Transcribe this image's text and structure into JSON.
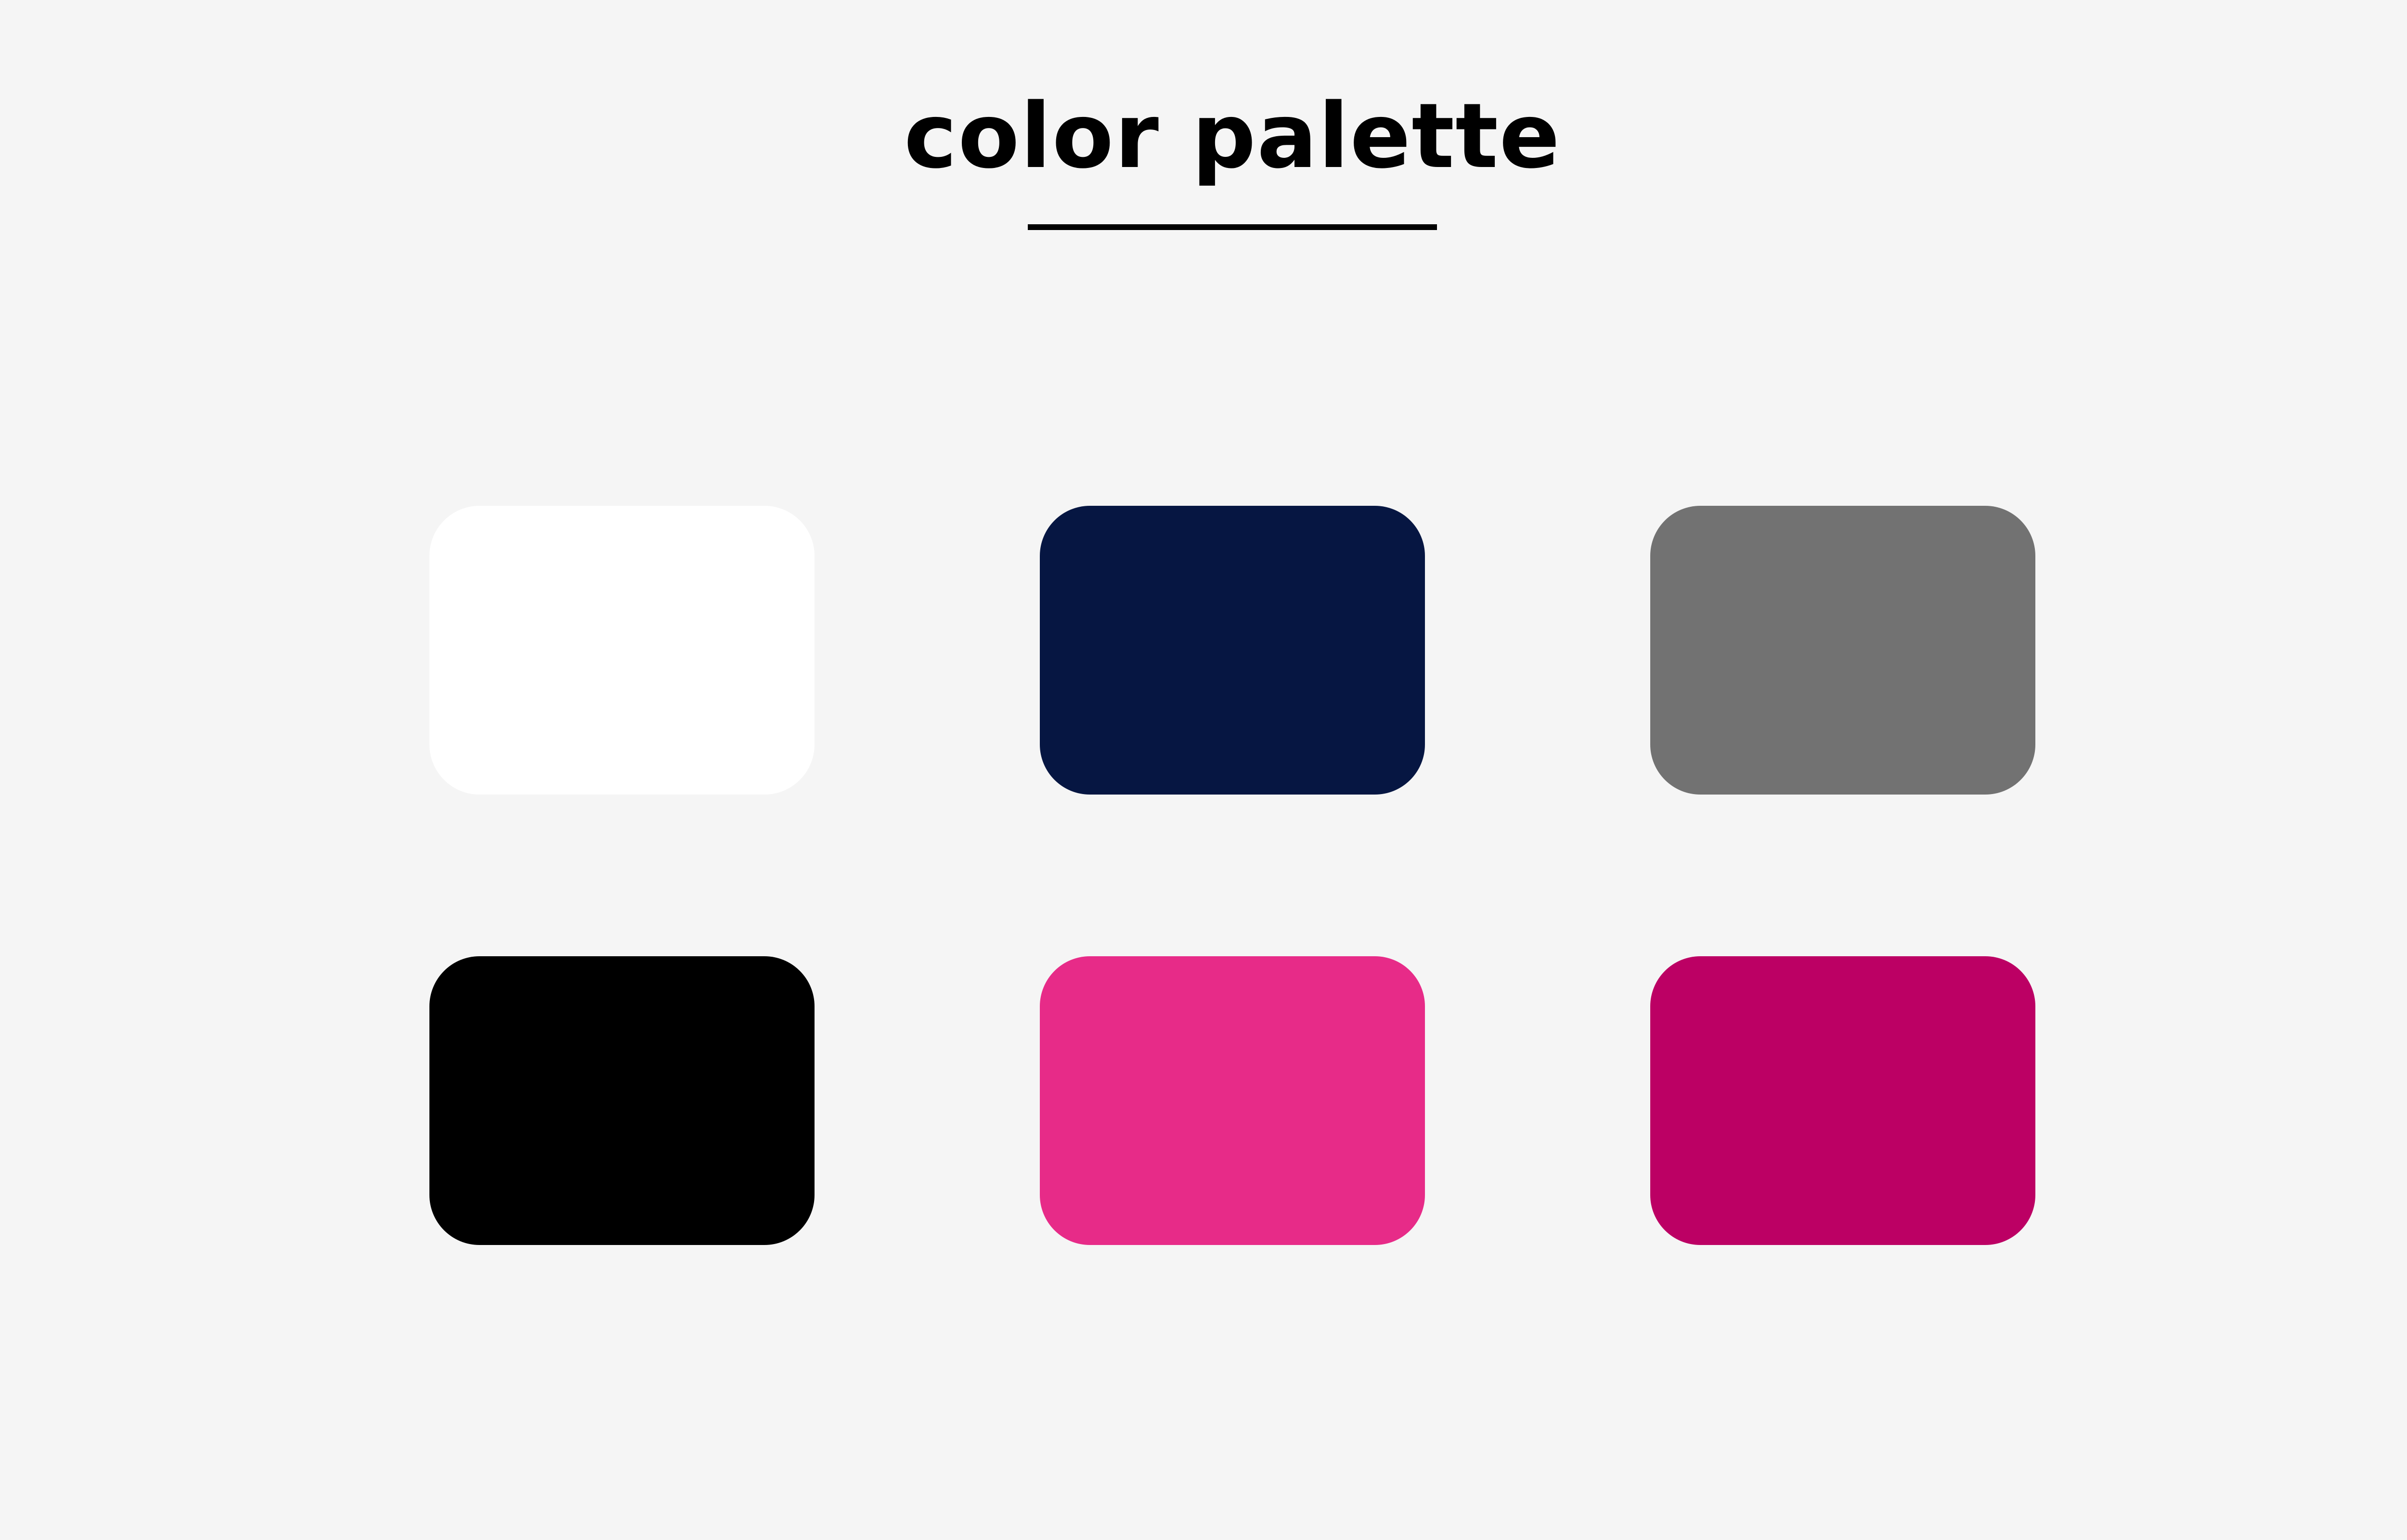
{
  "title": "color palette",
  "swatches": [
    {
      "color": "#ffffff"
    },
    {
      "color": "#061642"
    },
    {
      "color": "#727272"
    },
    {
      "color": "#000000"
    },
    {
      "color": "#e72b88"
    },
    {
      "color": "#bc0064"
    }
  ]
}
